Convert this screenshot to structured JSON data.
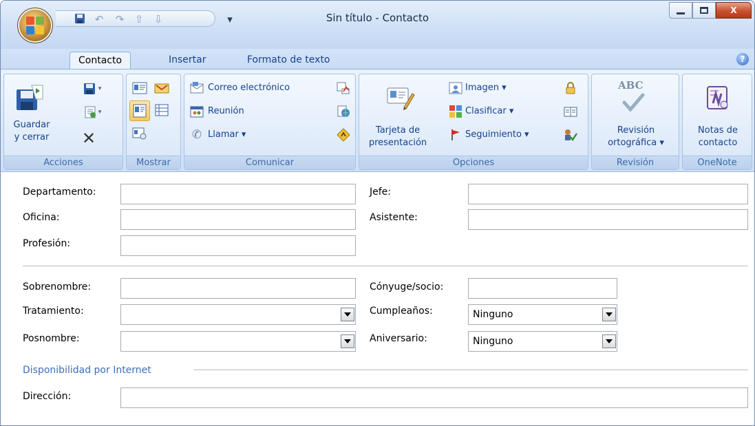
{
  "window": {
    "title": "Sin título - Contacto",
    "qat": {
      "save_icon": "save-icon",
      "undo_icon": "undo-icon",
      "redo_icon": "redo-icon",
      "prev_icon": "up-arrow-icon",
      "next_icon": "down-arrow-icon",
      "customize": "▾"
    },
    "controls": {
      "minimize": "▁",
      "maximize": "▢",
      "close": "X"
    }
  },
  "tabs": [
    {
      "label": "Contacto",
      "active": true
    },
    {
      "label": "Insertar",
      "active": false
    },
    {
      "label": "Formato de texto",
      "active": false
    }
  ],
  "ribbon": {
    "groups": {
      "acciones": {
        "label": "Acciones",
        "save_close_line1": "Guardar",
        "save_close_line2": "y cerrar"
      },
      "mostrar": {
        "label": "Mostrar"
      },
      "comunicar": {
        "label": "Comunicar",
        "email": "Correo electrónico",
        "meeting": "Reunión",
        "call": "Llamar ▾"
      },
      "opciones": {
        "label": "Opciones",
        "card_line1": "Tarjeta de",
        "card_line2": "presentación",
        "image": "Imagen ▾",
        "categorize": "Clasificar ▾",
        "followup": "Seguimiento ▾"
      },
      "revision": {
        "label": "Revisión",
        "abc": "ABC",
        "spell_line1": "Revisión",
        "spell_line2": "ortográfica ▾"
      },
      "onenote": {
        "label": "OneNote",
        "notes_line1": "Notas de",
        "notes_line2": "contacto"
      }
    }
  },
  "form": {
    "departamento": {
      "label": "Departamento:",
      "value": ""
    },
    "oficina": {
      "label": "Oficina:",
      "value": ""
    },
    "profesion": {
      "label": "Profesión:",
      "value": ""
    },
    "jefe": {
      "label": "Jefe:",
      "value": ""
    },
    "asistente": {
      "label": "Asistente:",
      "value": ""
    },
    "sobrenombre": {
      "label": "Sobrenombre:",
      "value": ""
    },
    "tratamiento": {
      "label": "Tratamiento:",
      "value": ""
    },
    "posnombre": {
      "label": "Posnombre:",
      "value": ""
    },
    "conyuge": {
      "label": "Cónyuge/socio:",
      "value": ""
    },
    "cumpleanos": {
      "label": "Cumpleaños:",
      "value": "Ninguno"
    },
    "aniversario": {
      "label": "Aniversario:",
      "value": "Ninguno"
    },
    "internet_section": "Disponibilidad por Internet",
    "direccion": {
      "label": "Dirección:",
      "value": ""
    }
  }
}
